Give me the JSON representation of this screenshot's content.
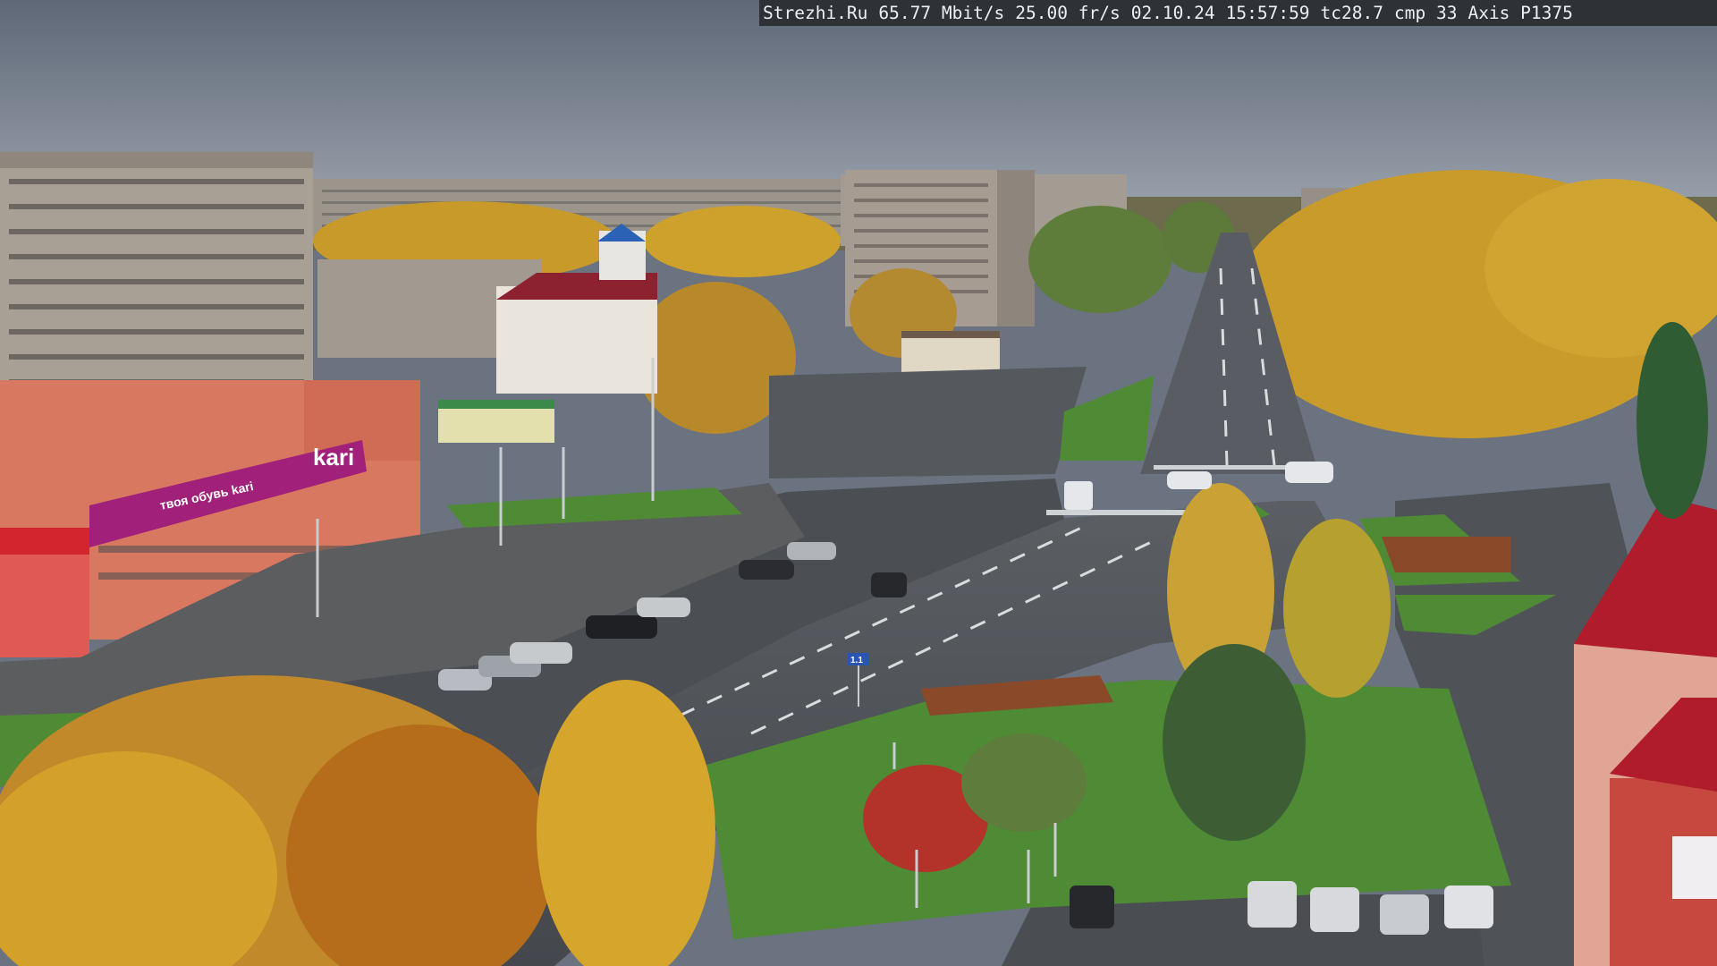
{
  "overlay": {
    "site": "Strezhi.Ru",
    "bitrate": "65.77 Mbit/s",
    "framerate": "25.00 fr/s",
    "date": "02.10.24",
    "time": "15:57:59",
    "tc": "tc28.7",
    "cmp": "cmp 33",
    "camera": "Axis P1375"
  },
  "signs": {
    "store_logo": "kari",
    "store_banner": "твоя обувь kari",
    "road_sign": "1.1"
  },
  "colors": {
    "sky": "#7d8694",
    "road": "#4f5358",
    "grass": "#4f8a35",
    "foliage": "#d3a52a",
    "kari_banner": "#a0207a",
    "roof_red": "#b01c2c"
  }
}
